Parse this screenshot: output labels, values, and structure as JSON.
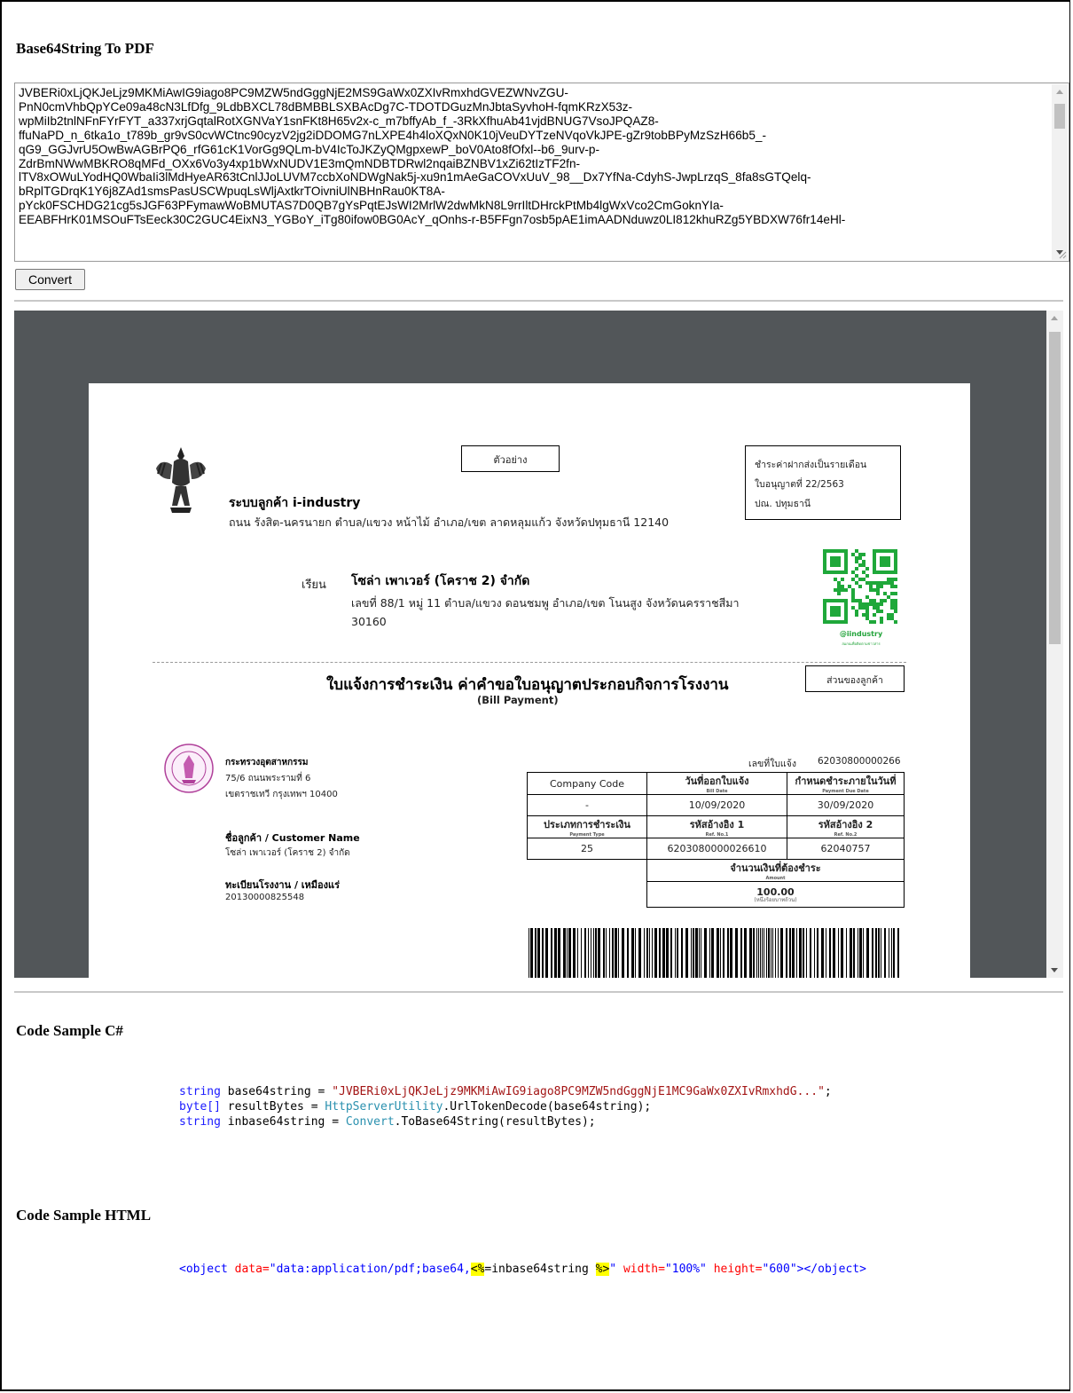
{
  "section1": {
    "title": "Base64String To PDF",
    "textarea_lines": [
      "JVBERi0xLjQKJeLjz9MKMiAwIG9iago8PC9MZW5ndGggNjE2MS9GaWx0ZXIvRmxhdGVEZWNvZGU-",
      "PnN0cmVhbQpYCe09a48cN3LfDfg_9LdbBXCL78dBMBBLSXBAcDg7C-TDOTDGuzMnJbtaSyvhoH-fqmKRzX53z-",
      "wpMiIb2tnlNFnFYrFYT_a337xrjGqtalRotXGNVaY1snFKt8H65v2x-c_m7bffyAb_f_-3RkXfhuAb41vjdBNUG7VsoJPQAZ8-",
      "ffuNaPD_n_6tka1o_t789b_gr9vS0cvWCtnc90cyzV2jg2iDDOMG7nLXPE4h4loXQxN0K10jVeuDYTzeNVqoVkJPE-gZr9tobBPyMzSzH66b5_-",
      "qG9_GGJvrU5OwBwAGBrPQ6_rfG61cK1VorGg9QLm-bV4IcToJKZyQMgpxewP_boV0Ato8fOfxl--b6_9urv-p-",
      "ZdrBmNWwMBKRO8qMFd_OXx6Vo3y4xp1bWxNUDV1E3mQmNDBTDRwl2nqaiBZNBV1xZi62tIzTF2fn-",
      "lTV8xOWuLYodHQ0WbaIi3lMdHyeAR63tCnlJJoLUVM7ccbXoNDWgNak5j-xu9n1mAeGaCOVxUuV_98__Dx7YfNa-CdyhS-JwpLrzqS_8fa8sGTQelq-",
      "bRplTGDrqK1Y6j8ZAd1smsPasUSCWpuqLsWljAxtkrTOivniUlNBHnRau0KT8A-",
      "pYck0FSCHDG21cg5sJGF63PFymawWoBMUTAS7D0QB7gYsPqtEJsWI2MrlW2dwMkN8L9rrIltDHrckPtMb4lgWxVco2CmGoknYIa-",
      "EEABFHrK01MSOuFTsEeck30C2GUC4EixN3_YGBoY_iTg80ifow0BG0AcY_qOnhs-r-B5FFgn7osb5pAE1imAADNduwz0LI812khuRZg5YBDXW76fr14eHl-"
    ],
    "convert_label": "Convert"
  },
  "pdf": {
    "sample_box": "ตัวอย่าง",
    "org_name": "ระบบลูกค้า i-industry",
    "org_address": "ถนน รังสิต-นครนายก ตำบล/แขวง หน้าไม้ อำเภอ/เขต ลาดหลุมแก้ว จังหวัดปทุมธานี 12140",
    "postage_line1": "ชำระค่าฝากส่งเป็นรายเดือน",
    "postage_line2": "ใบอนุญาตที่ 22/2563",
    "postage_line3": "ปณ. ปทุมธานี",
    "to_label": "เรียน",
    "to_name": "โซล่า เพาเวอร์ (โคราช 2) จำกัด",
    "to_address_line1": "เลขที่ 88/1 หมู่ 11 ตำบล/แขวง ดอนชมพู อำเภอ/เขต โนนสูง จังหวัดนครราชสีมา",
    "to_address_line2": "30160",
    "qr_caption": "@iindustry",
    "qr_subcaption": "สแกนเพื่อติดตามข่าวสาร",
    "bill_title": "ใบแจ้งการชำระเงิน ค่าคำขอใบอนุญาตประกอบกิจการโรงงาน",
    "bill_subtitle": "(Bill Payment)",
    "copy_box": "ส่วนของลูกค้า",
    "ministry_name": "กระทรวงอุตสาหกรรม",
    "ministry_addr1": "75/6 ถนนพระรามที่ 6",
    "ministry_addr2": "เขตราชเทวี กรุงเทพฯ 10400",
    "customer_label": "ชื่อลูกค้า / Customer Name",
    "customer_value": "โซล่า เพาเวอร์ (โคราช 2) จำกัด",
    "factory_label": "ทะเบียนโรงงาน / เหมืองแร่",
    "factory_value": "20130000825548",
    "invoice_label": "เลขที่ใบแจ้ง",
    "invoice_value": "62030800000266",
    "table": {
      "h_company": "Company Code",
      "h_billdate": "วันที่ออกใบแจ้ง",
      "h_billdate_en": "Bill Date",
      "h_due": "กำหนดชำระภายในวันที่",
      "h_due_en": "Payment Due Date",
      "v_company": "-",
      "v_billdate": "10/09/2020",
      "v_due": "30/09/2020",
      "h_ptype": "ประเภทการชำระเงิน",
      "h_ptype_en": "Payment Type",
      "h_ref1": "รหัสอ้างอิง 1",
      "h_ref1_en": "Ref. No.1",
      "h_ref2": "รหัสอ้างอิง 2",
      "h_ref2_en": "Ref. No.2",
      "v_ptype": "25",
      "v_ref1": "6203080000026610",
      "v_ref2": "62040757",
      "h_amount": "จำนวนเงินที่ต้องชำระ",
      "h_amount_en": "Amount",
      "v_amount": "100.00",
      "v_amount_text": "(หนึ่งร้อยบาทถ้วน)"
    }
  },
  "section2": {
    "title": "Code Sample C#",
    "line1_kw": "string",
    "line1_mid": " base64string = ",
    "line1_str": "\"JVBERi0xLjQKJeLjz9MKMiAwIG9iago8PC9MZW5ndGggNjE1MC9GaWx0ZXIvRmxhdG...\"",
    "line1_end": ";",
    "line2_kw": "byte[]",
    "line2_mid": " resultBytes = ",
    "line2_cls": "HttpServerUtility",
    "line2_end": ".UrlTokenDecode(base64string);",
    "line3_kw": "string",
    "line3_mid": " inbase64string = ",
    "line3_cls": "Convert",
    "line3_end": ".ToBase64String(resultBytes);"
  },
  "section3": {
    "title": "Code Sample HTML",
    "tag_open": "<object ",
    "attr_data": "data=",
    "val_data": "\"data:application/pdf;base64,",
    "hl_open": "<%",
    "expr": "=inbase64string ",
    "hl_close": "%>",
    "quote": "\"",
    "attr_width": " width=",
    "val_width": "\"100%\"",
    "attr_height": " height=",
    "val_height": "\"600\"",
    "tag_close": "></object>"
  }
}
